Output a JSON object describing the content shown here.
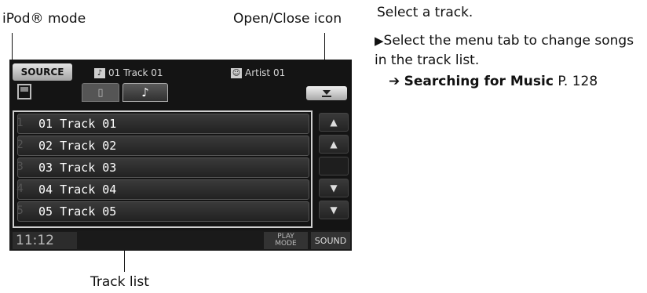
{
  "callouts": {
    "ipod_mode": "iPod® mode",
    "open_close": "Open/Close icon",
    "track_list": "Track list"
  },
  "screen": {
    "source_label": "SOURCE",
    "now_track": "01 Track 01",
    "now_artist": "Artist 01",
    "tracks": [
      {
        "num": "1",
        "title": "01 Track 01"
      },
      {
        "num": "2",
        "title": "02 Track 02"
      },
      {
        "num": "3",
        "title": "03 Track 03"
      },
      {
        "num": "4",
        "title": "04 Track 04"
      },
      {
        "num": "5",
        "title": "05 Track 05"
      }
    ],
    "clock": "11:12",
    "play_mode_line1": "PLAY",
    "play_mode_line2": "MODE",
    "sound_label": "SOUND"
  },
  "instructions": {
    "heading": "Select a track.",
    "step_text": "Select the menu tab to change songs in the track list.",
    "ref_title": "Searching for Music",
    "ref_page": "P. 128"
  }
}
